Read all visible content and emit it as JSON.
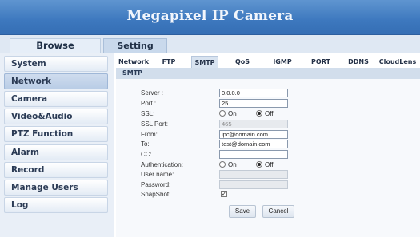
{
  "header": {
    "title": "Megapixel IP Camera"
  },
  "top_tabs": {
    "browse": "Browse",
    "setting": "Setting"
  },
  "sidebar": {
    "items": [
      {
        "label": "System"
      },
      {
        "label": "Network",
        "active": true
      },
      {
        "label": "Camera"
      },
      {
        "label": "Video&Audio"
      },
      {
        "label": "PTZ Function"
      },
      {
        "label": "Alarm"
      },
      {
        "label": "Record"
      },
      {
        "label": "Manage Users"
      },
      {
        "label": "Log"
      }
    ]
  },
  "network_tabs": [
    "Network",
    "FTP",
    "SMTP",
    "QoS",
    "IGMP",
    "PORT",
    "DDNS",
    "CloudLens"
  ],
  "active_network_tab": "SMTP",
  "section_title": "SMTP",
  "form": {
    "server": {
      "label": "Server :",
      "value": "0.0.0.0"
    },
    "port": {
      "label": "Port :",
      "value": "25"
    },
    "ssl": {
      "label": "SSL:",
      "on": "On",
      "off": "Off",
      "selected": "Off"
    },
    "ssl_port": {
      "label": "SSL Port:",
      "value": "465"
    },
    "from": {
      "label": "From:",
      "value": "ipc@domain.com"
    },
    "to": {
      "label": "To:",
      "value": "test@domain.com"
    },
    "cc": {
      "label": "CC:",
      "value": ""
    },
    "authentication": {
      "label": "Authentication:",
      "on": "On",
      "off": "Off",
      "selected": "Off"
    },
    "username": {
      "label": "User name:",
      "value": ""
    },
    "password": {
      "label": "Password:",
      "value": ""
    },
    "snapshot": {
      "label": "SnapShot:",
      "checked": true,
      "mark": "✓"
    }
  },
  "buttons": {
    "save": "Save",
    "cancel": "Cancel"
  }
}
